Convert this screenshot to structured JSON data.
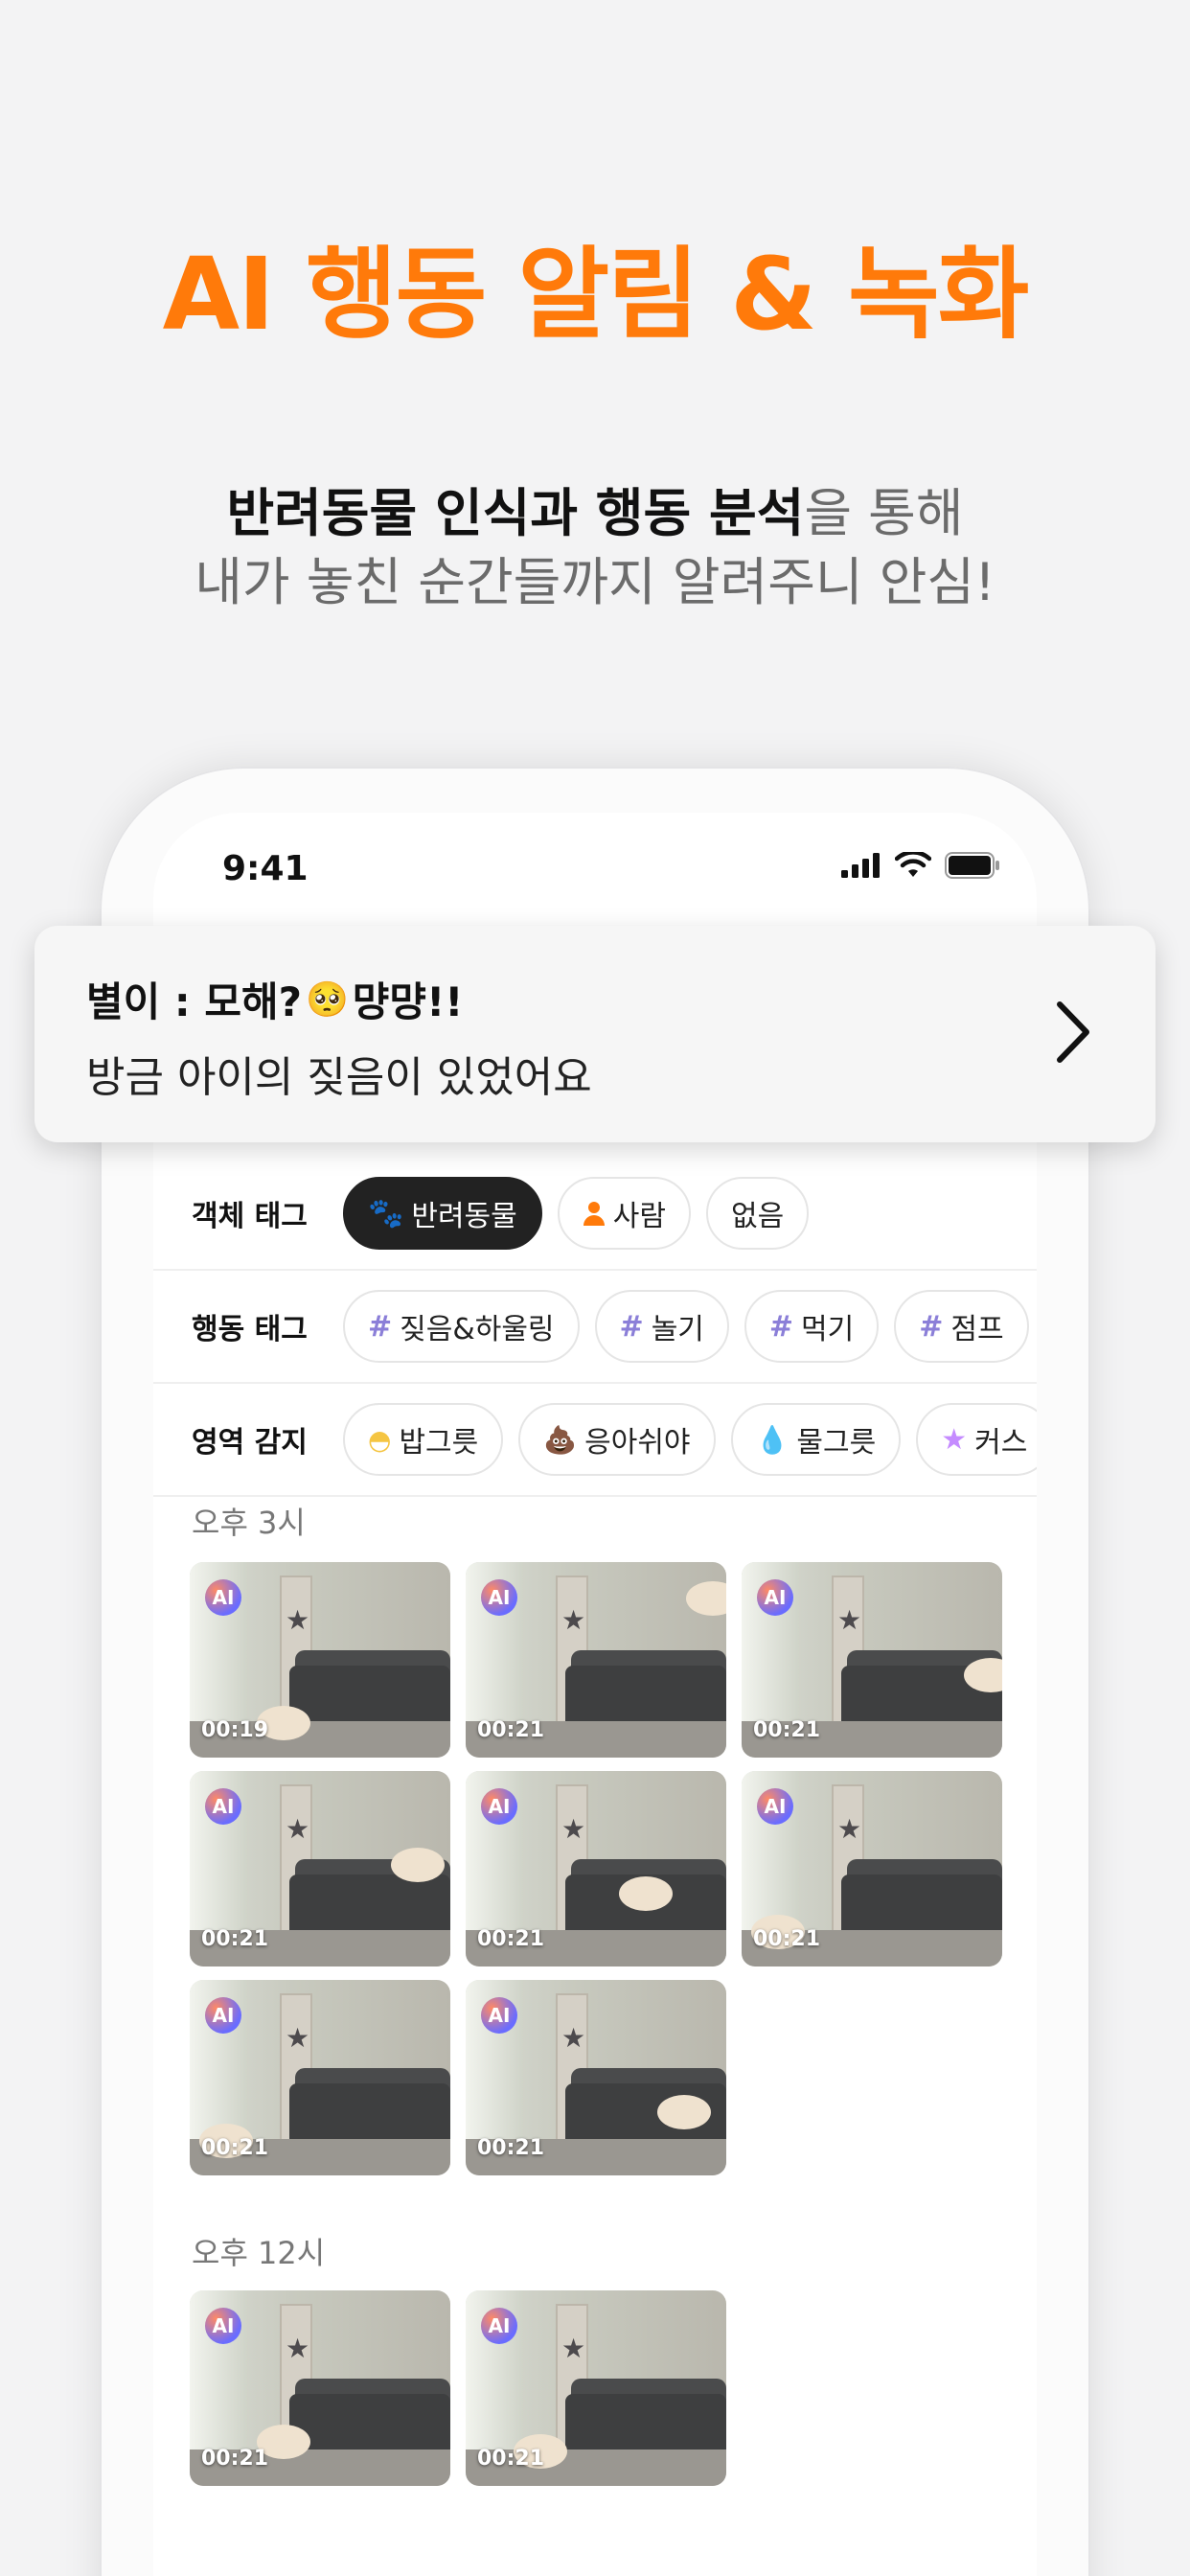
{
  "headline": "AI 행동 알림 & 녹화",
  "subhead": {
    "line1_bold": "반려동물 인식과 행동 분석",
    "line1_rest": "을 통해",
    "line2": "내가 놓친 순간들까지 알려주니 안심!"
  },
  "status_bar": {
    "time": "9:41"
  },
  "notification": {
    "title": "별이 : 모해?",
    "title_emoji": "🥺",
    "title_suffix": "먕먕!!",
    "body": "방금 아이의 짖음이 있었어요"
  },
  "filters": {
    "object": {
      "label": "객체 태그",
      "chips": [
        {
          "icon": "paw-icon",
          "label": "반려동물",
          "active": true
        },
        {
          "icon": "person-icon",
          "label": "사람",
          "active": false
        },
        {
          "icon": "",
          "label": "없음",
          "active": false
        }
      ]
    },
    "behavior": {
      "label": "행동 태그",
      "chips": [
        "짖음&하울링",
        "놀기",
        "먹기",
        "점프"
      ]
    },
    "zone": {
      "label": "영역 감지",
      "chips": [
        {
          "icon": "bowl-icon",
          "label": "밥그릇"
        },
        {
          "icon": "poop-icon",
          "label": "응아쉬야"
        },
        {
          "icon": "water-drop-icon",
          "label": "물그릇"
        },
        {
          "icon": "star-icon",
          "label": "커스"
        }
      ]
    }
  },
  "clip_groups": [
    {
      "label": "오후 3시",
      "clips": [
        {
          "badge": "AI",
          "duration": "00:19"
        },
        {
          "badge": "AI",
          "duration": "00:21"
        },
        {
          "badge": "AI",
          "duration": "00:21"
        },
        {
          "badge": "AI",
          "duration": "00:21"
        },
        {
          "badge": "AI",
          "duration": "00:21"
        },
        {
          "badge": "AI",
          "duration": "00:21"
        },
        {
          "badge": "AI",
          "duration": "00:21"
        },
        {
          "badge": "AI",
          "duration": "00:21"
        }
      ]
    },
    {
      "label": "오후 12시",
      "clips": [
        {
          "badge": "AI",
          "duration": "00:21"
        },
        {
          "badge": "AI",
          "duration": "00:21"
        }
      ]
    }
  ],
  "colors": {
    "accent": "#ff7a0a",
    "active_chip": "#222222",
    "hash": "#8b7fd8"
  }
}
